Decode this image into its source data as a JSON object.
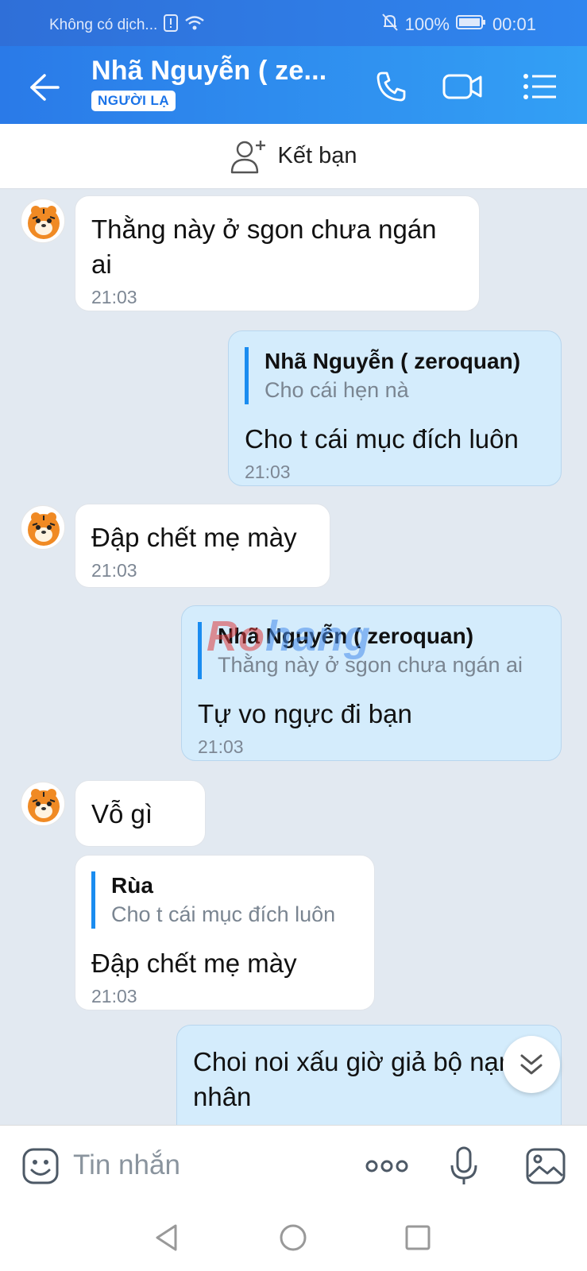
{
  "status_bar": {
    "carrier": "Không có dịch...",
    "battery": "100%",
    "time": "00:01"
  },
  "header": {
    "contact_name": "Nhã Nguyễn ( ze...",
    "badge": "NGƯỜI LẠ",
    "icons": [
      "back-arrow-icon",
      "phone-icon",
      "video-call-icon",
      "menu-icon"
    ]
  },
  "friend_bar": {
    "label": "Kết bạn"
  },
  "messages": [
    {
      "direction": "in",
      "text": "Thằng này ở sgon chưa ngán ai",
      "time": "21:03"
    },
    {
      "direction": "out",
      "quote_name": "Nhã Nguyễn ( zeroquan)",
      "quote_text": "Cho cái hẹn nà",
      "text": "Cho t cái mục đích luôn",
      "time": "21:03"
    },
    {
      "direction": "in",
      "text": "Đập chết mẹ mày",
      "time": "21:03"
    },
    {
      "direction": "out",
      "quote_name": "Nhã Nguyễn ( zeroquan)",
      "quote_text": "Thằng này ở sgon chưa ngán ai",
      "text": "Tự vo ngực đi bạn",
      "time": "21:03"
    },
    {
      "direction": "in",
      "text": "Vỗ gì"
    },
    {
      "direction": "in",
      "quote_name": "Rùa",
      "quote_text": "Cho t cái mục đích luôn",
      "text": "Đập chết mẹ mày",
      "time": "21:03"
    },
    {
      "direction": "out",
      "text": "Choi noi xấu giờ giả bộ nạn nhân"
    }
  ],
  "watermark": {
    "part_a": "Ro",
    "part_b": "hang"
  },
  "input_bar": {
    "placeholder": "Tin nhắn"
  },
  "colors": {
    "header": "#2a7ae8",
    "incoming_bubble": "#ffffff",
    "outgoing_bubble": "#d4ecfc",
    "quote_bar": "#1a8cf0",
    "background": "#e2e9f1"
  }
}
